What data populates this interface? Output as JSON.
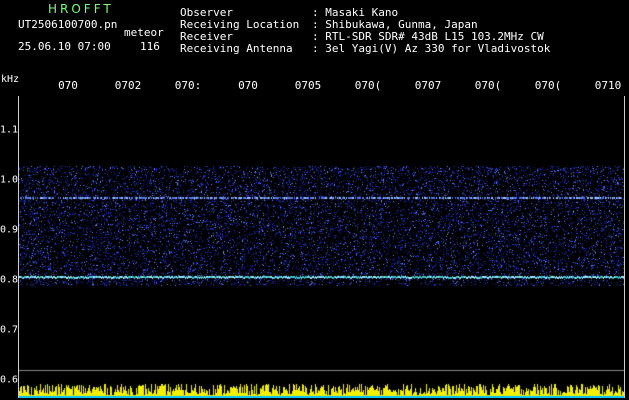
{
  "header": {
    "title": "HROFFT",
    "filename": "UT2506100700.pn",
    "suffix": "meteor",
    "datetime": "25.06.10 07:00",
    "count": "116",
    "rows": [
      {
        "key": "Observer",
        "value": ": Masaki Kano"
      },
      {
        "key": "Receiving Location",
        "value": ": Shibukawa, Gunma, Japan"
      },
      {
        "key": "Receiver",
        "value": ": RTL-SDR SDR# 43dB L15 103.2MHz CW"
      },
      {
        "key": "Receiving Antenna",
        "value": ": 3el Yagi(V) Az 330 for Vladivostok"
      }
    ]
  },
  "axis": {
    "y_unit": "kHz",
    "y_ticks": [
      "1.1",
      "1.0",
      "0.9",
      "0.8",
      "0.7",
      "0.6"
    ],
    "x_ticks": [
      "070",
      "0702",
      "070:",
      "070",
      "0705",
      "070(",
      "0707",
      "070(",
      "070(",
      "0710"
    ]
  },
  "colors": {
    "background": "#000000",
    "title": "#7CFC7C",
    "noise": "#1E3CC8",
    "signal_line": "#9FE8FF",
    "bottom_band": "#F0F000"
  }
}
